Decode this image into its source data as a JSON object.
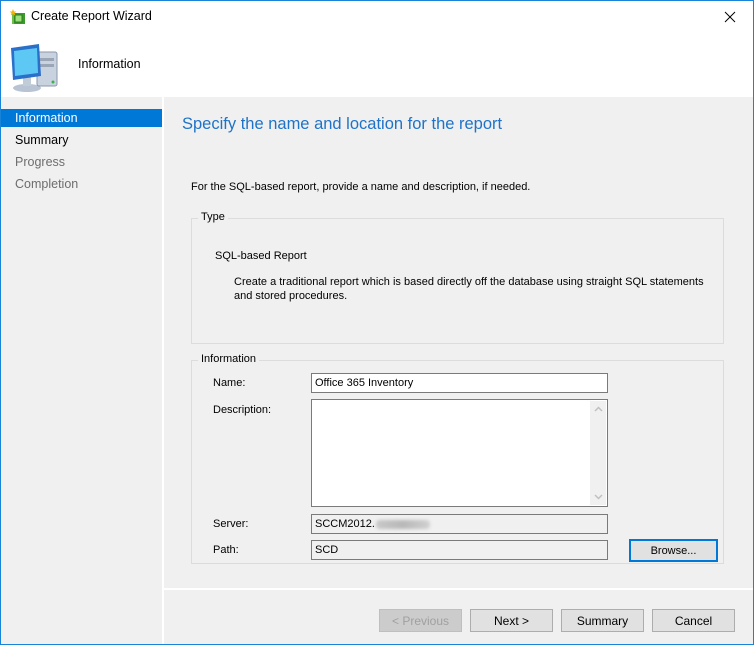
{
  "window": {
    "title": "Create Report Wizard",
    "icon": "wizard-icon",
    "close_icon": "close-icon"
  },
  "header": {
    "title": "Information",
    "icon": "computer-icon"
  },
  "sidebar": {
    "items": [
      {
        "label": "Information",
        "state": "active"
      },
      {
        "label": "Summary",
        "state": "normal"
      },
      {
        "label": "Progress",
        "state": "disabled"
      },
      {
        "label": "Completion",
        "state": "disabled"
      }
    ]
  },
  "main": {
    "title": "Specify the name and location for the report",
    "intro": "For the SQL-based report, provide a name and description, if needed.",
    "type_group": {
      "label": "Type",
      "type_name": "SQL-based Report",
      "type_description": "Create a traditional report which is based directly off the database using straight SQL statements and stored procedures."
    },
    "info_group": {
      "label": "Information",
      "name_label": "Name:",
      "name_value": "Office 365 Inventory",
      "description_label": "Description:",
      "description_value": "",
      "server_label": "Server:",
      "server_value": "SCCM2012.",
      "path_label": "Path:",
      "path_value": "SCD",
      "browse_label": "Browse..."
    }
  },
  "footer": {
    "previous_label": "< Previous",
    "next_label": "Next >",
    "summary_label": "Summary",
    "cancel_label": "Cancel"
  },
  "colors": {
    "accent": "#0078d7",
    "title_blue": "#1e73c8",
    "window_border": "#1883d7"
  }
}
